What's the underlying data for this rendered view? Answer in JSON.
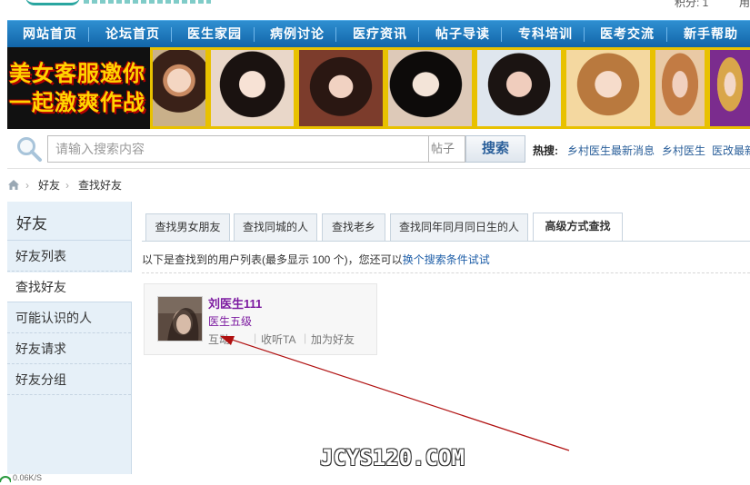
{
  "topbar": {
    "credits_fragment": "积分: 1",
    "right_fragment": "用"
  },
  "nav": {
    "items": [
      "网站首页",
      "论坛首页",
      "医生家园",
      "病例讨论",
      "医疗资讯",
      "帖子导读",
      "专科培训",
      "医考交流",
      "新手帮助"
    ]
  },
  "banner": {
    "line1": "美女客服邀你",
    "line2": "一起激爽作战"
  },
  "search": {
    "placeholder": "请输入搜索内容",
    "type": "帖子",
    "button": "搜索",
    "hot_label": "热搜:",
    "hot_links": [
      "乡村医生最新消息",
      "乡村医生",
      "医改最新"
    ]
  },
  "breadcrumb": {
    "items": [
      "好友",
      "查找好友"
    ]
  },
  "sidebar": {
    "title": "好友",
    "items": [
      "好友列表",
      "查找好友",
      "可能认识的人",
      "好友请求",
      "好友分组"
    ],
    "active": "查找好友"
  },
  "tabs": {
    "items": [
      "查找男女朋友",
      "查找同城的人",
      "查找老乡",
      "查找同年同月同日生的人",
      "高级方式查找"
    ],
    "active": "高级方式查找"
  },
  "results": {
    "note_prefix": "以下是查找到的用户列表(最多显示 100 个)，您还可以",
    "note_link": "换个搜索条件试试"
  },
  "user_card": {
    "name": "刘医生111",
    "level": "医生五级",
    "actions": [
      "互动",
      "收听TA",
      "加为好友"
    ]
  },
  "watermark": "JCYS120.COM",
  "statusbar": {
    "speed": "0.06K/S"
  },
  "colors": {
    "nav": "#1a72b8",
    "annotation_arrow": "#b01010",
    "username": "#7c1aa0",
    "link": "#1f5fa8"
  }
}
